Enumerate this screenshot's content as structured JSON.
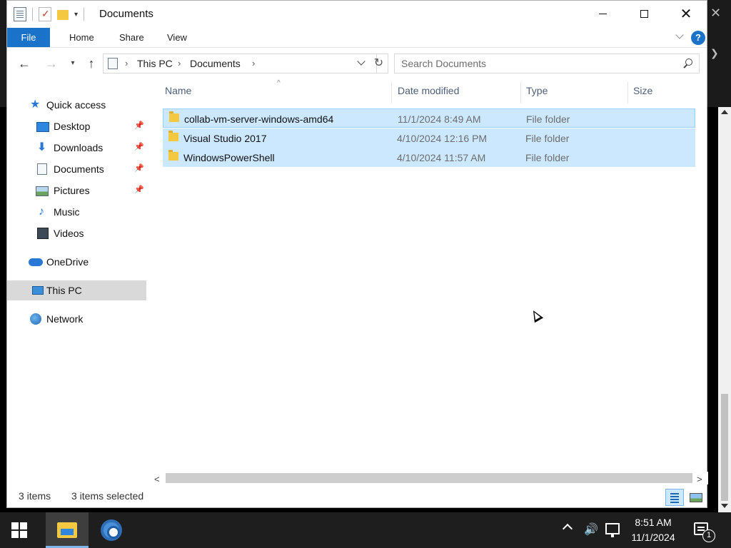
{
  "window": {
    "title": "Documents",
    "close_glyph": "✕"
  },
  "quick_access_toolbar": {
    "dropdown_glyph": "▾"
  },
  "ribbon": {
    "tabs": [
      {
        "label": "File"
      },
      {
        "label": "Home"
      },
      {
        "label": "Share"
      },
      {
        "label": "View"
      }
    ],
    "help_glyph": "?",
    "accent_color": "#1a73c8"
  },
  "navigation": {
    "back_glyph": "←",
    "forward_glyph": "→",
    "recent_glyph": "▾",
    "up_glyph": "↑",
    "refresh_glyph": "↻",
    "breadcrumb": [
      "This PC",
      "Documents"
    ],
    "separator_glyph": "›"
  },
  "search": {
    "placeholder": "Search Documents"
  },
  "sidebar": {
    "items": [
      {
        "label": "Quick access",
        "icon": "star-icon"
      },
      {
        "label": "Desktop",
        "icon": "desktop-icon",
        "pinned": true
      },
      {
        "label": "Downloads",
        "icon": "download-icon",
        "pinned": true
      },
      {
        "label": "Documents",
        "icon": "documents-icon",
        "pinned": true
      },
      {
        "label": "Pictures",
        "icon": "pictures-icon",
        "pinned": true
      },
      {
        "label": "Music",
        "icon": "music-icon"
      },
      {
        "label": "Videos",
        "icon": "videos-icon"
      },
      {
        "label": "OneDrive",
        "icon": "onedrive-icon"
      },
      {
        "label": "This PC",
        "icon": "this-pc-icon",
        "selected": true
      },
      {
        "label": "Network",
        "icon": "network-icon"
      }
    ],
    "pin_glyph": "📌",
    "star_glyph": "★",
    "download_glyph": "⬇",
    "music_glyph": "♪"
  },
  "filelist": {
    "sort_glyph": "^",
    "columns": [
      "Name",
      "Date modified",
      "Type",
      "Size"
    ],
    "rows": [
      {
        "name": "collab-vm-server-windows-amd64",
        "date": "11/1/2024 8:49 AM",
        "type": "File folder",
        "size": ""
      },
      {
        "name": "Visual Studio 2017",
        "date": "4/10/2024 12:16 PM",
        "type": "File folder",
        "size": ""
      },
      {
        "name": "WindowsPowerShell",
        "date": "4/10/2024 11:57 AM",
        "type": "File folder",
        "size": ""
      }
    ],
    "selection_color": "#cce8ff"
  },
  "scrollbar": {
    "left_glyph": "<",
    "right_glyph": ">"
  },
  "status": {
    "item_count": "3 items",
    "selected_count": "3 items selected"
  },
  "taskbar": {
    "time": "8:51 AM",
    "date": "11/1/2024",
    "notification_count": "1",
    "volume_glyph": "🔊"
  }
}
